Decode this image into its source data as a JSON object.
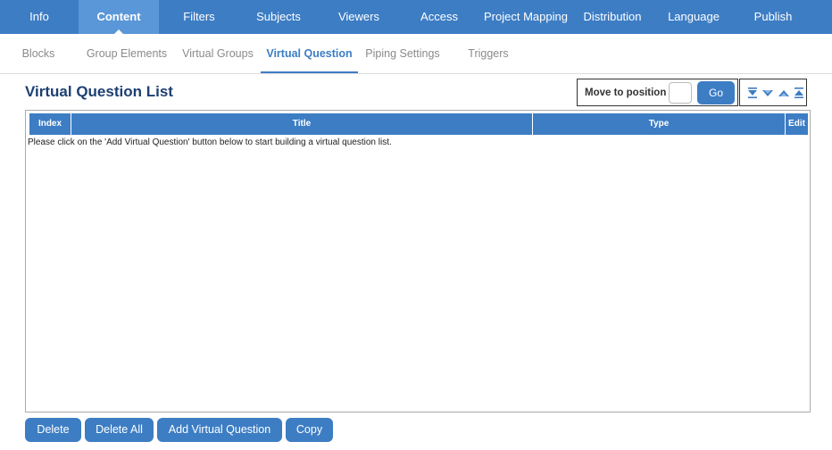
{
  "top_nav": {
    "tabs": [
      {
        "label": "Info"
      },
      {
        "label": "Content"
      },
      {
        "label": "Filters"
      },
      {
        "label": "Subjects"
      },
      {
        "label": "Viewers"
      },
      {
        "label": "Access"
      },
      {
        "label": "Project Mapping"
      },
      {
        "label": "Distribution"
      },
      {
        "label": "Language"
      },
      {
        "label": "Publish"
      }
    ],
    "active": "Content"
  },
  "sub_nav": {
    "tabs": [
      {
        "label": "Blocks"
      },
      {
        "label": "Group Elements"
      },
      {
        "label": "Virtual Groups"
      },
      {
        "label": "Virtual Question"
      },
      {
        "label": "Piping Settings"
      },
      {
        "label": "Triggers"
      }
    ],
    "active": "Virtual Question"
  },
  "page": {
    "title": "Virtual Question List"
  },
  "move": {
    "label": "Move to position",
    "value": "",
    "go_label": "Go"
  },
  "reorder_icons": [
    "move-to-bottom-icon",
    "move-down-icon",
    "move-up-icon",
    "move-to-top-icon"
  ],
  "table": {
    "columns": [
      "Index",
      "Title",
      "Type",
      "Edit"
    ],
    "empty_message": "Please click on the 'Add Virtual Question' button below to start building a virtual question list."
  },
  "actions": {
    "delete": "Delete",
    "delete_all": "Delete All",
    "add_virtual_question": "Add Virtual Question",
    "copy": "Copy"
  },
  "colors": {
    "nav_bg": "#3d7dc4",
    "nav_active": "#5a97d8",
    "title": "#1d3f72"
  }
}
